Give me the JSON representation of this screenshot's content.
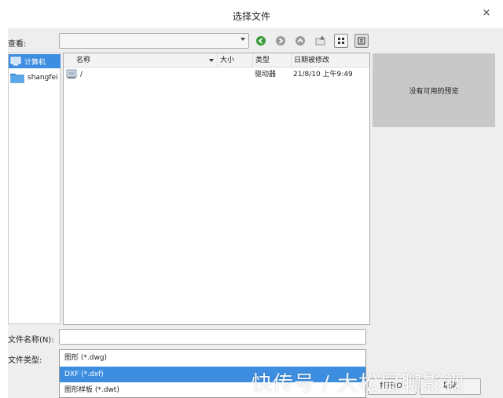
{
  "window": {
    "title": "选择文件",
    "close_glyph": "×"
  },
  "lookin": {
    "label": "查看:",
    "value": ""
  },
  "sidebar": {
    "items": [
      {
        "label": "计算机",
        "icon": "computer-icon",
        "selected": true
      },
      {
        "label": "shangfei",
        "icon": "folder-icon",
        "selected": false
      }
    ]
  },
  "file_list": {
    "columns": [
      "名称",
      "大小",
      "类型",
      "日期被修改"
    ],
    "rows": [
      {
        "name": "/",
        "size": "",
        "type": "驱动器",
        "modified": "21/8/10 上午9:49",
        "icon": "drive-icon"
      }
    ]
  },
  "preview": {
    "text": "没有可用的预览"
  },
  "filename": {
    "label": "文件名称(N):",
    "value": ""
  },
  "filetype": {
    "label": "文件类型:",
    "options": [
      "图形 (*.dwg)",
      "DXF (*.dxf)",
      "图形样板 (*.dwt)"
    ],
    "selected_index": 1
  },
  "buttons": {
    "open": "打开(O)",
    "cancel": "取消"
  },
  "watermark": "快传号 / 大松鼠聊影视",
  "colors": {
    "accent": "#3d8ee0",
    "preview_bg": "#c8c8c8",
    "dialog_bg": "#eeeeee"
  }
}
